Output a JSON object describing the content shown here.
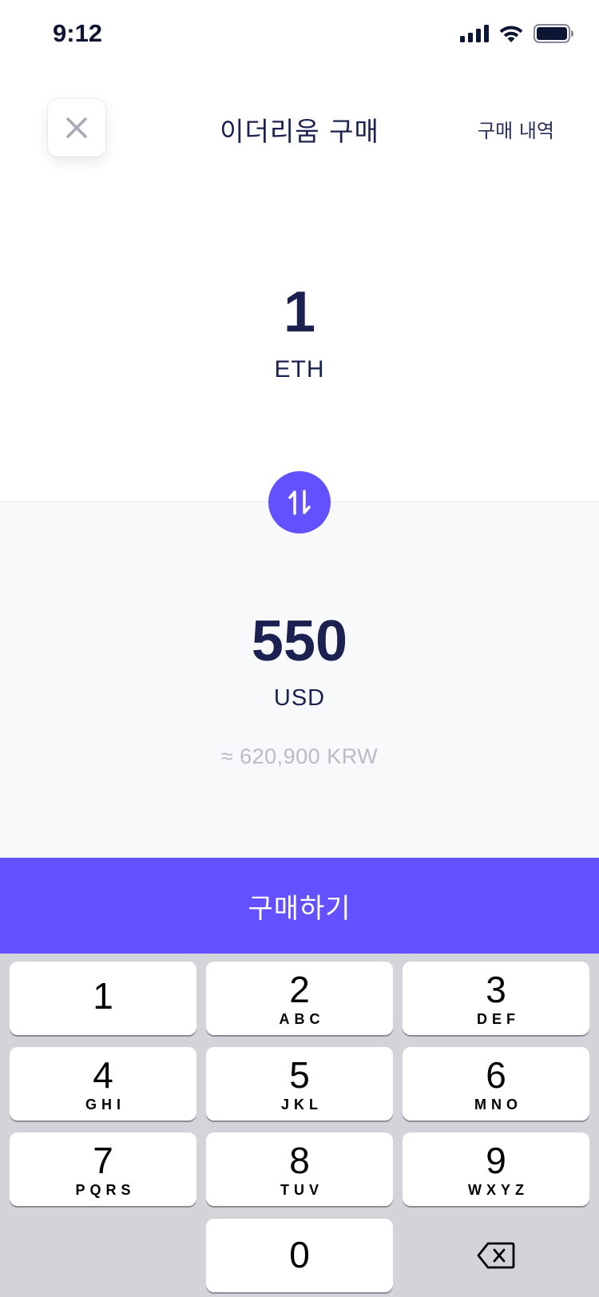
{
  "status_bar": {
    "time": "9:12",
    "icons": [
      "signal-icon",
      "wifi-icon",
      "battery-icon"
    ]
  },
  "header": {
    "close_icon": "close-icon",
    "title": "이더리움 구매",
    "history_label": "구매 내역"
  },
  "crypto": {
    "amount": "1",
    "unit": "ETH"
  },
  "swap_icon": "swap-vertical-icon",
  "fiat": {
    "amount": "550",
    "unit": "USD",
    "converted": "≈ 620,900 KRW"
  },
  "buy_button_label": "구매하기",
  "keypad": {
    "keys": [
      {
        "digit": "1",
        "letters": ""
      },
      {
        "digit": "2",
        "letters": "ABC"
      },
      {
        "digit": "3",
        "letters": "DEF"
      },
      {
        "digit": "4",
        "letters": "GHI"
      },
      {
        "digit": "5",
        "letters": "JKL"
      },
      {
        "digit": "6",
        "letters": "MNO"
      },
      {
        "digit": "7",
        "letters": "PQRS"
      },
      {
        "digit": "8",
        "letters": "TUV"
      },
      {
        "digit": "9",
        "letters": "WXYZ"
      },
      {
        "digit": "0",
        "letters": ""
      }
    ],
    "backspace_icon": "backspace-icon"
  },
  "colors": {
    "accent": "#6351ff",
    "text_primary": "#1b2150",
    "text_muted": "#b8bcc6",
    "panel_bg": "#f8f9fa",
    "keypad_bg": "#d2d4da"
  }
}
